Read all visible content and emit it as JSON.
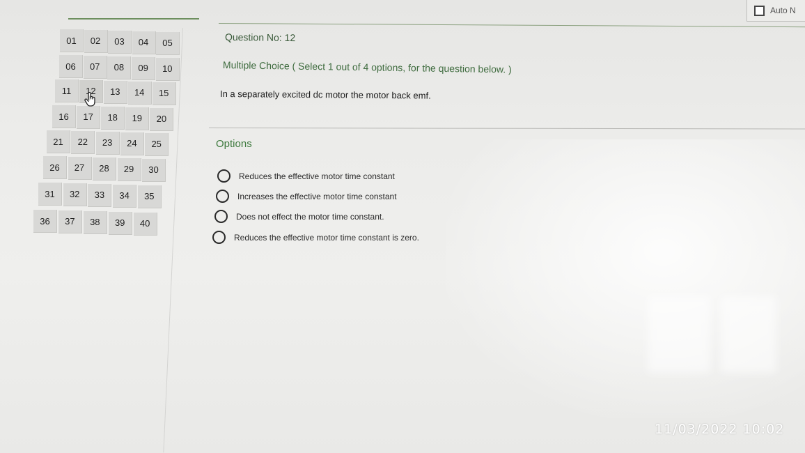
{
  "auto_next": {
    "label": "Auto N",
    "checked": false
  },
  "question_grid": {
    "rows": [
      [
        "01",
        "02",
        "03",
        "04",
        "05"
      ],
      [
        "06",
        "07",
        "08",
        "09",
        "10"
      ],
      [
        "11",
        "12",
        "13",
        "14",
        "15"
      ],
      [
        "16",
        "17",
        "18",
        "19",
        "20"
      ],
      [
        "21",
        "22",
        "23",
        "24",
        "25"
      ],
      [
        "26",
        "27",
        "28",
        "29",
        "30"
      ],
      [
        "31",
        "32",
        "33",
        "34",
        "35"
      ],
      [
        "36",
        "37",
        "38",
        "39",
        "40"
      ]
    ],
    "current": "12"
  },
  "question": {
    "number_label": "Question No: 12",
    "type_label": "Multiple Choice ( Select 1 out of 4 options, for the question below. )",
    "text": "In a separately excited dc motor the motor back emf."
  },
  "options_heading": "Options",
  "options": [
    "Reduces the effective motor time constant",
    "Increases the effective motor time constant",
    "Does not effect the motor time constant.",
    "Reduces the effective motor time constant is zero."
  ],
  "photo_timestamp": "11/03/2022 10:02",
  "colors": {
    "accent_green": "#3e7a3e",
    "cell_bg": "#d8d8d6"
  }
}
